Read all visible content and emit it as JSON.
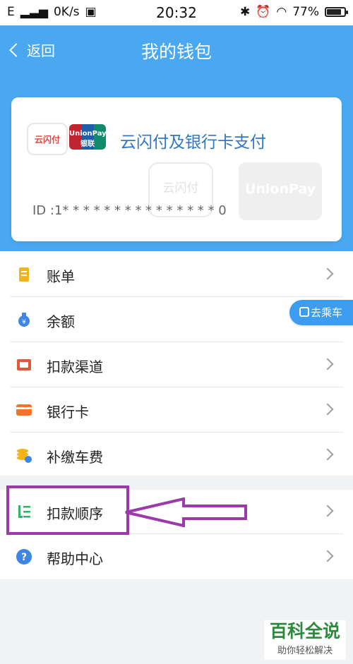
{
  "status": {
    "carrier": "E",
    "speed": "0K/s",
    "time": "20:32",
    "battery": "77%"
  },
  "header": {
    "back_label": "返回",
    "title": "我的钱包"
  },
  "card": {
    "title": "云闪付及银行卡支付",
    "logo_app": "云闪付",
    "logo_unionpay": "UnionPay 银联",
    "watermark_left": "云闪付",
    "watermark_right": "UnionPay 银联",
    "id_text": "ID :1* * * * * * * * * * * * * * * 0"
  },
  "menu": {
    "bill": "账单",
    "balance": "余额",
    "deduct_channel": "扣款渠道",
    "bank_card": "银行卡",
    "pay_fee": "补缴车费",
    "deduct_order": "扣款顺序",
    "help": "帮助中心"
  },
  "floating": {
    "bus_label": "去乘车"
  },
  "watermark": {
    "line1": "百科全说",
    "line2": "助你轻松解决"
  },
  "colors": {
    "accent": "#4aa8f0",
    "highlight": "#9b3aa8",
    "watermark_green": "#2c8a3c"
  },
  "icons": [
    "bill-icon",
    "money-bag-icon",
    "channel-icon",
    "bank-card-icon",
    "coins-icon",
    "order-icon",
    "help-icon"
  ]
}
